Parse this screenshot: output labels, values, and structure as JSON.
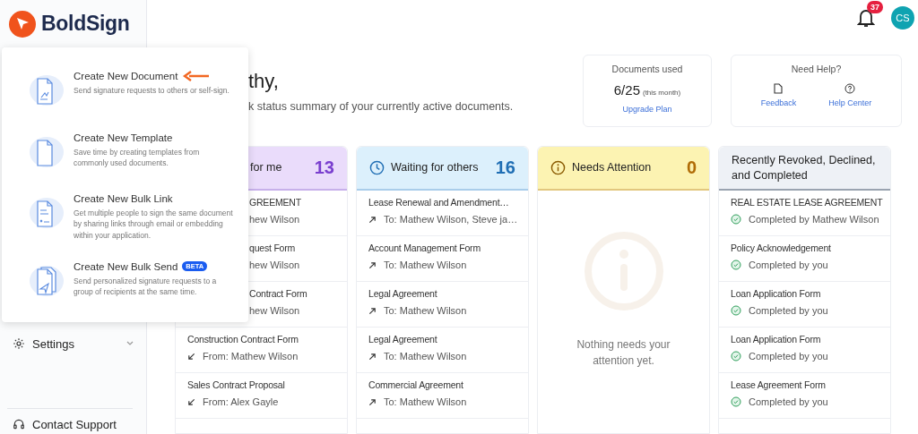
{
  "brand": {
    "name": "BoldSign"
  },
  "header": {
    "notification_count": "37",
    "avatar_initials": "CS"
  },
  "sidebar": {
    "items": [
      {
        "label": "Settings",
        "kind": "settings"
      },
      {
        "label": "Contact Support",
        "kind": "support"
      }
    ]
  },
  "create_menu": {
    "items": [
      {
        "title": "Create New Document",
        "description": "Send signature requests to others or self-sign.",
        "kind": "document",
        "pointed": true
      },
      {
        "title": "Create New Template",
        "description": "Save time by creating templates from commonly used documents.",
        "kind": "template",
        "pointed": false
      },
      {
        "title": "Create New Bulk Link",
        "description": "Get multiple people to sign the same document by sharing links through email or embedding within your application.",
        "kind": "bulk-link",
        "pointed": false
      },
      {
        "title": "Create New Bulk Send",
        "badge": "BETA",
        "description": "Send personalized signature requests to a group of recipients at the same time.",
        "kind": "bulk-send",
        "pointed": false
      }
    ]
  },
  "greeting": {
    "title": "thy,",
    "subtitle": "k status summary of your currently active documents."
  },
  "usage_card": {
    "title": "Documents used",
    "count": "6/25",
    "period": "(this month)",
    "link": "Upgrade Plan"
  },
  "help_card": {
    "title": "Need Help?",
    "links": [
      {
        "label": "Feedback",
        "kind": "feedback"
      },
      {
        "label": "Help Center",
        "kind": "help"
      }
    ]
  },
  "columns": [
    {
      "kind": "action",
      "title": "for me",
      "count": "13",
      "rows": [
        {
          "name": "GREEMENT",
          "detail": "hew Wilson",
          "kind": "plain"
        },
        {
          "name": "quest Form",
          "detail": "hew Wilson",
          "kind": "plain"
        },
        {
          "name": "Contract Form",
          "detail": "hew Wilson",
          "kind": "plain"
        },
        {
          "name": "Construction Contract Form",
          "detail": "From: Mathew Wilson",
          "kind": "from"
        },
        {
          "name": "Sales Contract Proposal",
          "detail": "From: Alex Gayle",
          "kind": "from"
        }
      ]
    },
    {
      "kind": "waiting",
      "title": "Waiting for others",
      "count": "16",
      "rows": [
        {
          "name": "Lease Renewal and Amendment…",
          "detail": "To: Mathew Wilson, Steve ja…",
          "kind": "to"
        },
        {
          "name": "Account Management Form",
          "detail": "To: Mathew Wilson",
          "kind": "to"
        },
        {
          "name": "Legal Agreement",
          "detail": "To: Mathew Wilson",
          "kind": "to"
        },
        {
          "name": "Legal Agreement",
          "detail": "To: Mathew Wilson",
          "kind": "to"
        },
        {
          "name": "Commercial Agreement",
          "detail": "To: Mathew Wilson",
          "kind": "to"
        }
      ]
    },
    {
      "kind": "attention",
      "title": "Needs Attention",
      "count": "0",
      "empty_message": "Nothing needs your attention yet."
    },
    {
      "kind": "recent",
      "title": "Recently Revoked, Declined, and Completed",
      "rows": [
        {
          "name": "REAL ESTATE LEASE AGREEMENT",
          "detail": "Completed by Mathew Wilson",
          "kind": "completed"
        },
        {
          "name": "Policy Acknowledgement",
          "detail": "Completed by you",
          "kind": "completed"
        },
        {
          "name": "Loan Application Form",
          "detail": "Completed by you",
          "kind": "completed"
        },
        {
          "name": "Loan Application Form",
          "detail": "Completed by you",
          "kind": "completed"
        },
        {
          "name": "Lease Agreement Form",
          "detail": "Completed by you",
          "kind": "completed"
        }
      ]
    }
  ]
}
